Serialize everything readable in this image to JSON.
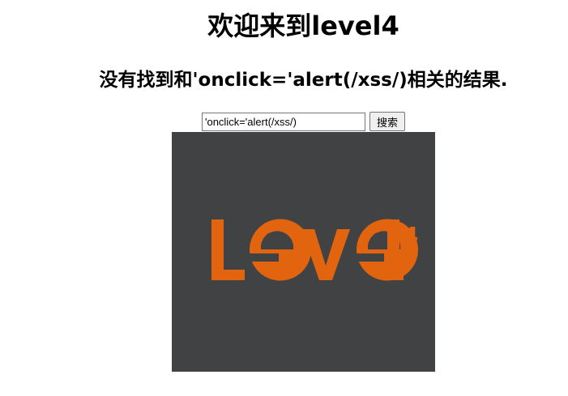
{
  "page": {
    "title": "欢迎来到level4",
    "result_message": "没有找到和'onclick='alert(/xss/)相关的结果."
  },
  "search": {
    "value": "'onclick='alert(/xss/)",
    "button_label": "搜索"
  },
  "level_image": {
    "logo_text": "level4",
    "background_color": "#414244",
    "logo_color": "#e2640f"
  }
}
